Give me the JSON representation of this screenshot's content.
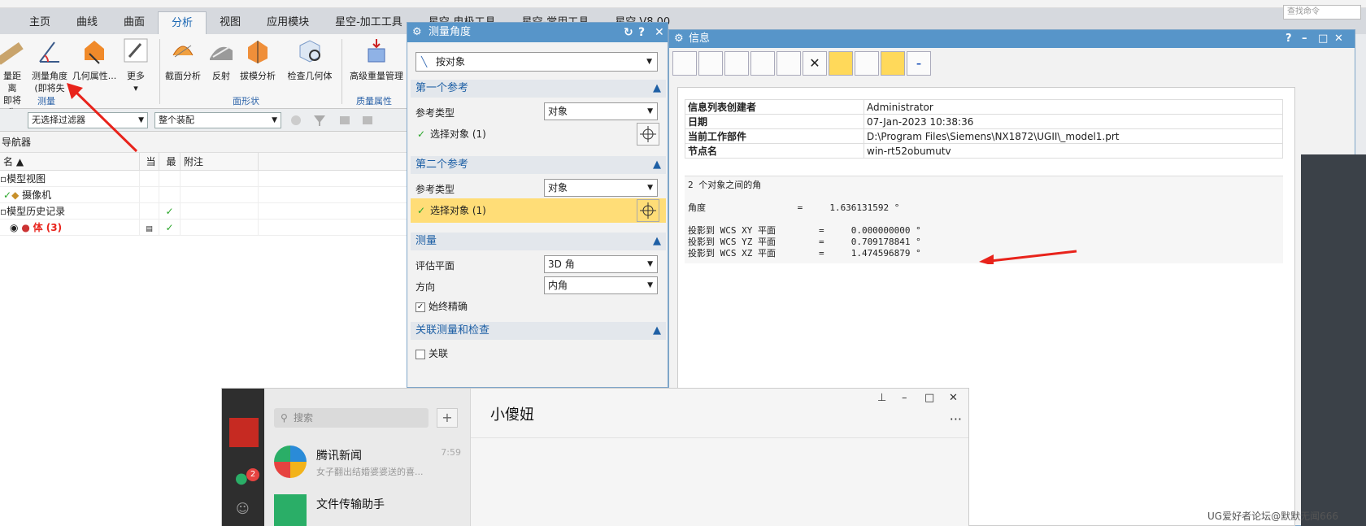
{
  "ribbon": {
    "tabs": [
      "主页",
      "曲线",
      "曲面",
      "分析",
      "视图",
      "应用模块",
      "星空-加工工具",
      "星空-电极工具",
      "星空-常用工具",
      "星空 V8.00"
    ],
    "search_placeholder": "查找命令",
    "buttons": [
      {
        "label": "量距离",
        "sub": "即将失"
      },
      {
        "label": "测量角度",
        "sub": "(即将失"
      },
      {
        "label": "几何属性...",
        "sub": ""
      },
      {
        "label": "更多",
        "sub": ""
      },
      {
        "label": "截面分析",
        "sub": ""
      },
      {
        "label": "反射",
        "sub": ""
      },
      {
        "label": "拔模分析",
        "sub": ""
      },
      {
        "label": "检查几何体",
        "sub": ""
      },
      {
        "label": "高级重量管理",
        "sub": ""
      }
    ],
    "groups": [
      "测量",
      "面形状",
      "质量属性"
    ]
  },
  "filterbar": {
    "filter": "无选择过滤器",
    "assembly": "整个装配"
  },
  "navigator": {
    "title": "导航器",
    "headers": [
      "名",
      "当",
      "最",
      "附注"
    ],
    "rows": [
      {
        "name": "模型视图",
        "cur": "",
        "latest": "",
        "note": ""
      },
      {
        "name": "摄像机",
        "cur": "",
        "latest": "",
        "note": ""
      },
      {
        "name": "模型历史记录",
        "cur": "",
        "latest": "✓",
        "note": ""
      },
      {
        "name": "体 (3)",
        "cur": "",
        "latest": "✓",
        "note": ""
      }
    ]
  },
  "measure_dialog": {
    "title": "测量角度",
    "mode": "按对象",
    "sec1": {
      "title": "第一个参考",
      "ref_type_label": "参考类型",
      "ref_type": "对象",
      "select": "选择对象 (1)"
    },
    "sec2": {
      "title": "第二个参考",
      "ref_type_label": "参考类型",
      "ref_type": "对象",
      "select": "选择对象 (1)"
    },
    "sec3": {
      "title": "测量",
      "plane_label": "评估平面",
      "plane": "3D 角",
      "dir_label": "方向",
      "dir": "内角",
      "accurate": "始终精确"
    },
    "sec4": {
      "title": "关联测量和检查",
      "assoc": "关联"
    }
  },
  "info_window": {
    "title": "信息",
    "table": [
      {
        "k": "信息列表创建者",
        "v": "Administrator"
      },
      {
        "k": "日期",
        "v": "07-Jan-2023 10:38:36"
      },
      {
        "k": "当前工作部件",
        "v": "D:\\Program Files\\Siemens\\NX1872\\UGII\\_model1.prt"
      },
      {
        "k": "节点名",
        "v": "win-rt52obumutv"
      }
    ],
    "lines": [
      "2 个对象之间的角",
      "",
      "角度                 =     1.636131592 °",
      "",
      "投影到 WCS XY 平面        =     0.000000000 °",
      "投影到 WCS YZ 平面        =     0.709178841 °",
      "投影到 WCS XZ 平面        =     1.474596879 °"
    ]
  },
  "chat": {
    "search_placeholder": "搜索",
    "badge": "2",
    "contact_name": "小傻妞",
    "conversations": [
      {
        "name": "腾讯新闻",
        "time": "7:59",
        "preview": "女子翻出结婚婆婆送的喜..."
      },
      {
        "name": "文件传输助手",
        "time": "",
        "preview": ""
      }
    ]
  },
  "watermark": "UG爱好者论坛@默默无闻666",
  "colors": {
    "title_bar": "#5795c9",
    "accent_red": "#e8231b",
    "highlight": "#ffdd77"
  }
}
